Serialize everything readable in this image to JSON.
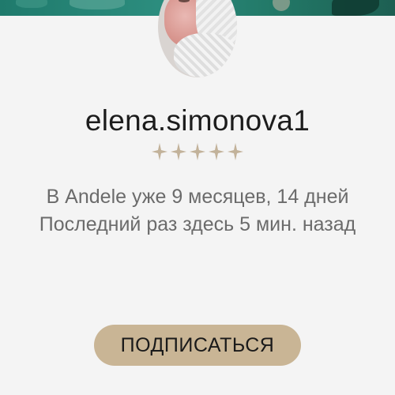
{
  "profile": {
    "username": "elena.simonova1",
    "rating": {
      "value": 0,
      "max": 5,
      "star_color": "#c2b29a"
    },
    "member_since_text": "В Andele уже 9 месяцев, 14 дней",
    "last_seen_text": "Последний раз здесь 5 мин. назад"
  },
  "actions": {
    "subscribe_label": "ПОДПИСАТЬСЯ"
  },
  "colors": {
    "accent": "#c9b595",
    "background": "#f4f4f4",
    "cover": "#1f7a6c"
  }
}
